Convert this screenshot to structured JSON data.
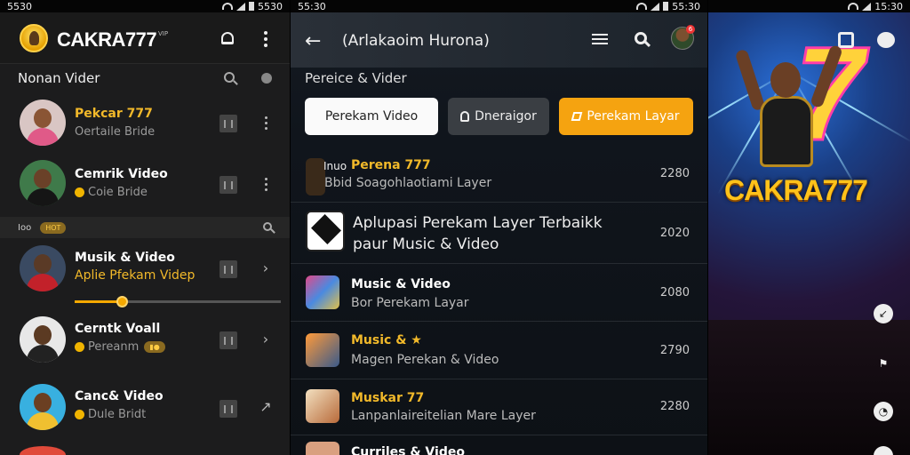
{
  "panel1": {
    "status_time": "5530",
    "status_right": "5530",
    "brand": "CAKRA777",
    "brand_tag": "VIP",
    "section1_title": "Nonan Vider",
    "items": [
      {
        "title": "Pekcar 777",
        "subtitle": "Oertaile Bride",
        "title_color": "#f2b92a"
      },
      {
        "title": "Cemrik Video",
        "subtitle": "Coie Bride",
        "title_color": "#ffffff"
      },
      {
        "title": "Musik & Video",
        "subtitle": "Aplie Pfekam Videp",
        "title_color": "#ffffff"
      },
      {
        "title": "Cerntk Voall",
        "subtitle": "Pereanm",
        "title_color": "#ffffff"
      },
      {
        "title": "Canc& Video",
        "subtitle": "Dule Bridt",
        "title_color": "#ffffff"
      }
    ],
    "section2_label": "Ioo",
    "section2_badge": "HOT",
    "progress": 0.23
  },
  "panel2": {
    "status_time": "55:30",
    "status_right": "55:30",
    "title": "(Arlakaoim Hurona)",
    "notif_count": "6",
    "section_title": "Pereice & Vider",
    "pills": [
      "Perekam Video",
      "Dneraigor",
      "Perekam Layar"
    ],
    "rows": [
      {
        "title": "Perena 777",
        "prefix": "Inuo",
        "subtitle": "Bbid Soagohlaotiami Layer",
        "value": "2280"
      },
      {
        "big": "Aplupasi Perekam Layer Terbaikk paur Music & Video",
        "value": "2020"
      },
      {
        "title": "Music & Video",
        "subtitle": "Bor Perekam Layar",
        "value": "2080"
      },
      {
        "title": "Music & ★",
        "subtitle": "Magen Perekan & Video",
        "value": "2790"
      },
      {
        "title": "Muskar 77",
        "subtitle": "Lanpanlaireitelian Mare Layer",
        "value": "2280"
      },
      {
        "title": "Curriles & Video",
        "subtitle": "",
        "value": ""
      }
    ]
  },
  "panel3": {
    "status_time": "15:30",
    "hero_brand": "CAKRA777"
  },
  "colors": {
    "accent_orange": "#f5a310",
    "accent_gold": "#f2b92a",
    "background": "#1c1c1d"
  },
  "icons": [
    "bell-icon",
    "kebab-icon",
    "search-icon",
    "back-arrow-icon",
    "list-icon",
    "person-icon",
    "edit-icon"
  ]
}
